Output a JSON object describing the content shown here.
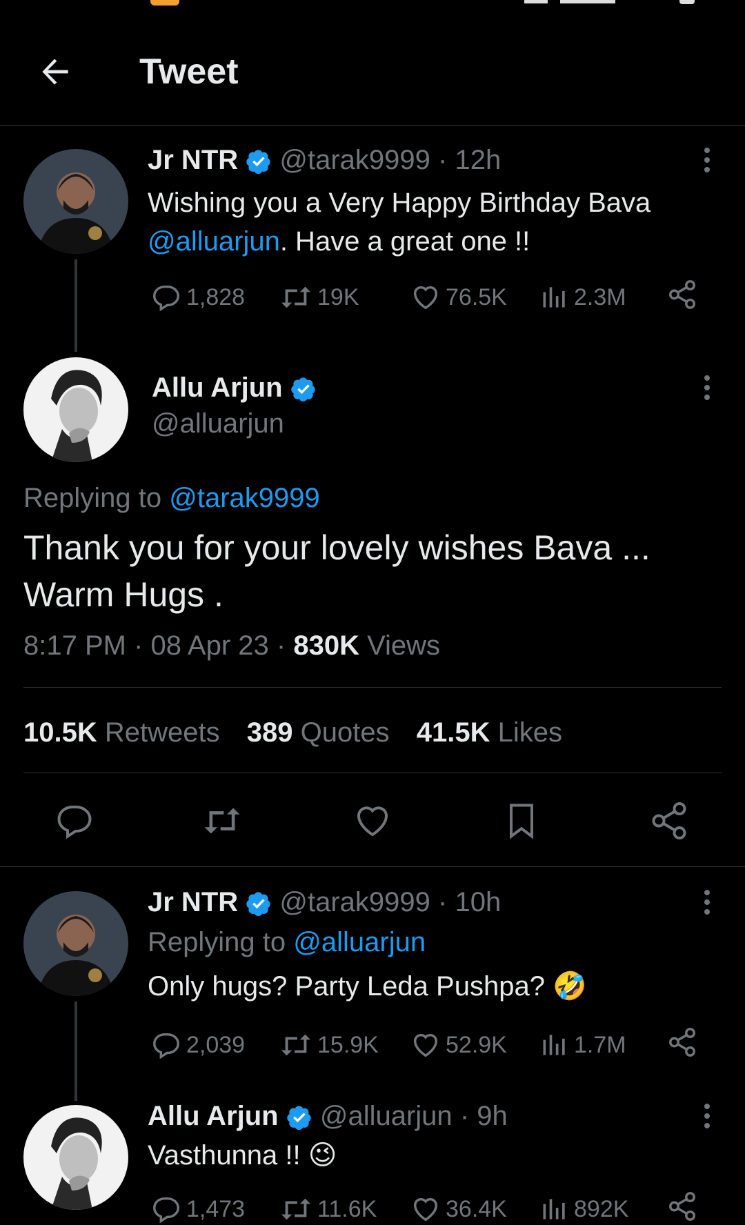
{
  "header": {
    "title": "Tweet"
  },
  "tweet1": {
    "name": "Jr NTR",
    "handle": "@tarak9999",
    "time": "· 12h",
    "text_pre": "Wishing you a Very Happy Birthday Bava",
    "mention": "@alluarjun",
    "text_post": ". Have a great one !!",
    "replies": "1,828",
    "retweets": "19K",
    "likes": "76.5K",
    "views": "2.3M"
  },
  "main": {
    "name": "Allu Arjun",
    "handle": "@alluarjun",
    "replying_label": "Replying to",
    "replying_to": "@tarak9999",
    "text_line1": "Thank you for your lovely wishes Bava ...",
    "text_line2": "Warm Hugs .",
    "timestamp": "8:17 PM · 08 Apr 23 ·",
    "views_count": "830K",
    "views_label": "Views",
    "retweets_count": "10.5K",
    "retweets_label": "Retweets",
    "quotes_count": "389",
    "quotes_label": "Quotes",
    "likes_count": "41.5K",
    "likes_label": "Likes"
  },
  "reply1": {
    "name": "Jr NTR",
    "handle": "@tarak9999",
    "time": "· 10h",
    "replying_label": "Replying to",
    "replying_to": "@alluarjun",
    "text": "Only hugs?  Party Leda Pushpa? 🤣",
    "replies": "2,039",
    "retweets": "15.9K",
    "likes": "52.9K",
    "views": "1.7M"
  },
  "reply2": {
    "name": "Allu Arjun",
    "handle": "@alluarjun",
    "time": "· 9h",
    "text": "Vasthunna !! 😉",
    "replies": "1,473",
    "retweets": "11.6K",
    "likes": "36.4K",
    "views": "892K"
  },
  "colors": {
    "accent": "#1d9bf0",
    "muted": "#71767b",
    "background": "#000000",
    "text": "#e7e9ea"
  }
}
